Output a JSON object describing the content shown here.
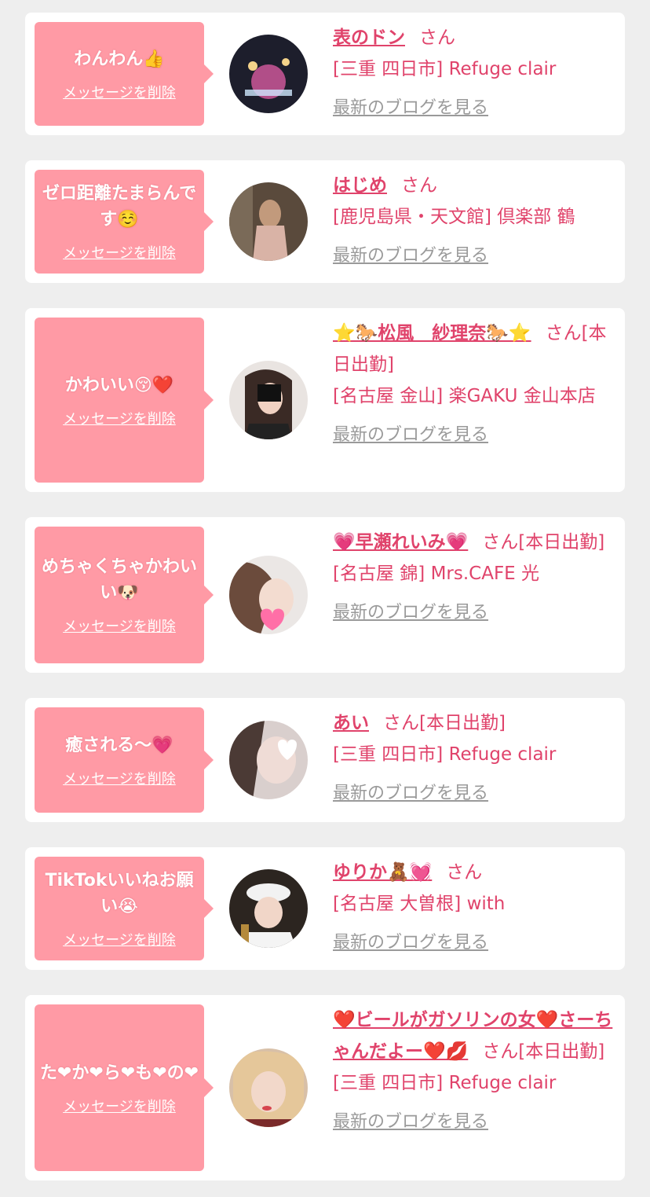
{
  "delete_label": "メッセージを削除",
  "blog_label": "最新のブログを見る",
  "san_label": "さん",
  "colors": {
    "bubble": "#ff9aa5",
    "accent": "#e0436b",
    "link_gray": "#9a9a9a",
    "background": "#eeeeee"
  },
  "cards": [
    {
      "message": "わんわん👍",
      "name": "表のドン",
      "san": "さん",
      "shop": "[三重 四日市] Refuge clair"
    },
    {
      "message": "ゼロ距離たまらんです☺️",
      "name": "はじめ",
      "san": "さん",
      "shop": "[鹿児島県・天文館] 倶楽部 鶴"
    },
    {
      "message": "かわいい😚❤️",
      "name": "⭐🐎松風　紗理奈🐎⭐",
      "san": "さん[本日出勤]",
      "shop": "[名古屋 金山] 楽GAKU 金山本店"
    },
    {
      "message": "めちゃくちゃかわいい🐶",
      "name": "💗早瀬れいみ💗",
      "san": "さん[本日出勤]",
      "shop": "[名古屋 錦] Mrs.CAFE 光"
    },
    {
      "message": "癒される〜💗",
      "name": "あい",
      "san": "さん[本日出勤]",
      "shop": "[三重 四日市] Refuge clair"
    },
    {
      "message": "TikTokいいねお願い😭",
      "name": "ゆりか🧸💓",
      "san": "さん",
      "shop": "[名古屋 大曽根] with"
    },
    {
      "message": "た❤か❤ら❤も❤の❤",
      "name": "❤️ビールがガソリンの女❤️さーちゃんだよー❤️💋",
      "san": "さん[本日出勤]",
      "shop": "[三重 四日市] Refuge clair"
    }
  ]
}
